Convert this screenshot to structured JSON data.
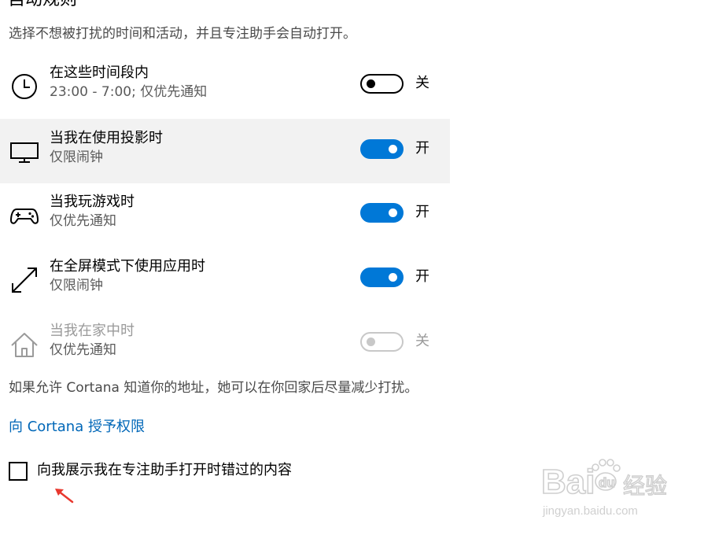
{
  "section": {
    "title": "自动规则",
    "description": "选择不想被打扰的时间和活动，并且专注助手会自动打开。"
  },
  "rules": [
    {
      "icon": "clock-icon",
      "title": "在这些时间段内",
      "subtitle": "23:00 - 7:00; 仅优先通知",
      "state": "关",
      "on": false
    },
    {
      "icon": "monitor-icon",
      "title": "当我在使用投影时",
      "subtitle": "仅限闹钟",
      "state": "开",
      "on": true
    },
    {
      "icon": "gamepad-icon",
      "title": "当我玩游戏时",
      "subtitle": "仅优先通知",
      "state": "开",
      "on": true
    },
    {
      "icon": "fullscreen-arrow-icon",
      "title": "在全屏模式下使用应用时",
      "subtitle": "仅限闹钟",
      "state": "开",
      "on": true
    },
    {
      "icon": "home-icon",
      "title": "当我在家中时",
      "subtitle": "仅优先通知",
      "state": "关",
      "on": false
    }
  ],
  "cortana": {
    "note": "如果允许 Cortana 知道你的地址，她可以在你回家后尽量减少打扰。",
    "link": "向 Cortana 授予权限"
  },
  "summary_checkbox": {
    "label": "向我展示我在专注助手打开时错过的内容",
    "checked": false
  },
  "colors": {
    "accent": "#0078d7",
    "link": "#0067b8",
    "hover_row": "#f2f2f2",
    "disabled": "#9a9a9a",
    "annotation": "#e8382e"
  },
  "watermark": {
    "brand": "Bai",
    "brand_suffix": "经验",
    "url": "jingyan.baidu.com"
  }
}
